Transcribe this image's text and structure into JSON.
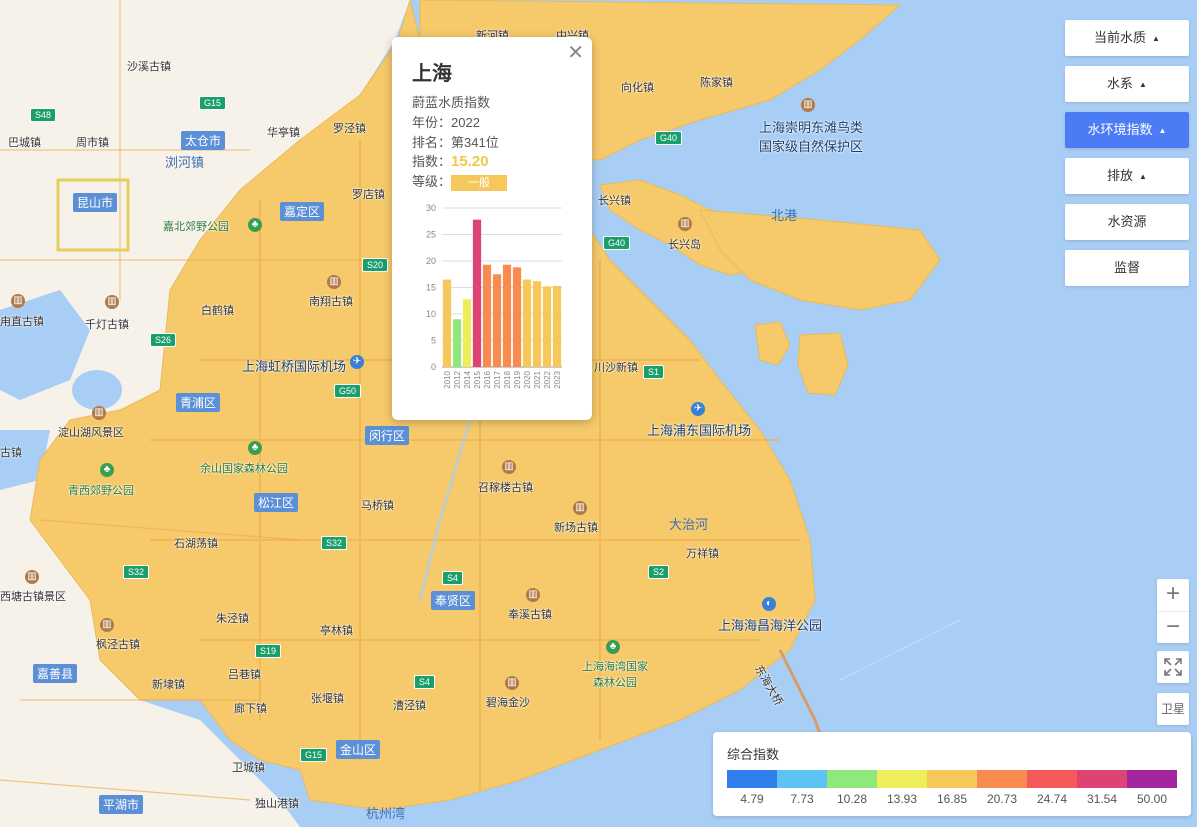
{
  "popup": {
    "city": "上海",
    "heading": "蔚蓝水质指数",
    "year_label": "年份：",
    "year": "2022",
    "rank_label": "排名：",
    "rank": "第341位",
    "index_label": "指数：",
    "index_value": "15.20",
    "grade_label": "等级：",
    "grade": "一般",
    "close_icon": "close-icon"
  },
  "chart_data": {
    "type": "bar",
    "categories": [
      "2010",
      "2012",
      "2014",
      "2015",
      "2016",
      "2017",
      "2018",
      "2019",
      "2020",
      "2021",
      "2022",
      "2023"
    ],
    "values": [
      16.5,
      9.0,
      12.8,
      27.8,
      19.3,
      17.5,
      19.3,
      18.8,
      16.5,
      16.2,
      15.2,
      15.3
    ],
    "colors": [
      "#f6c85c",
      "#8ee87c",
      "#eeee5c",
      "#de4473",
      "#f98b50",
      "#f98b50",
      "#f98b50",
      "#f98b50",
      "#f6c85c",
      "#f6c85c",
      "#f6c85c",
      "#f6c85c"
    ],
    "ylim": [
      0,
      30
    ],
    "yticks": [
      0,
      5,
      10,
      15,
      20,
      25,
      30
    ],
    "grid": true
  },
  "right_menu": [
    {
      "label": "当前水质",
      "arrow": "▲",
      "active": false
    },
    {
      "label": "水系",
      "arrow": "▲",
      "active": false
    },
    {
      "label": "水环境指数",
      "arrow": "▲",
      "active": true
    },
    {
      "label": "排放",
      "arrow": "▲",
      "active": false
    },
    {
      "label": "水资源",
      "arrow": "",
      "active": false
    },
    {
      "label": "监督",
      "arrow": "",
      "active": false
    }
  ],
  "zoom": {
    "in": "+",
    "out": "−",
    "fullscreen_icon": "fullscreen-icon",
    "satellite": "卫星"
  },
  "legend": {
    "title": "综合指数",
    "colors": [
      "#2f80ed",
      "#5cc3f5",
      "#8ee87c",
      "#eeee5c",
      "#f6c85c",
      "#f98b50",
      "#f55a5a",
      "#de4473",
      "#a326a0"
    ],
    "values": [
      "4.79",
      "7.73",
      "10.28",
      "13.93",
      "16.85",
      "20.73",
      "24.74",
      "31.54",
      "50.00"
    ]
  },
  "map_labels": {
    "towns": [
      "沙溪古镇",
      "浏河镇",
      "罗泾镇",
      "巴城镇",
      "周市镇",
      "华亭镇",
      "罗店镇",
      "嘉北郊野公园",
      "白鹤镇",
      "南翔古镇",
      "千灯古镇",
      "甪直古镇",
      "上海虹桥国际机场",
      "淀山湖风景区",
      "余山国家森林公园",
      "青西郊野公园",
      "召稼楼古镇",
      "马桥镇",
      "新场古镇",
      "大治河",
      "万祥镇",
      "石湖荡镇",
      "朱泾镇",
      "亭林镇",
      "奉溪古镇",
      "枫泾古镇",
      "新埭镇",
      "吕巷镇",
      "廊下镇",
      "张堰镇",
      "漕泾镇",
      "碧海金沙",
      "上海海湾国家森林公园",
      "上海海昌海洋公园",
      "独山港镇",
      "卫城镇",
      "上海浦东国际机场",
      "川沙新镇",
      "长兴镇",
      "长兴岛",
      "北港",
      "上海崇明东滩鸟类国家级自然保护区",
      "陈家镇",
      "向化镇",
      "新河镇",
      "中兴镇",
      "平湖市",
      "嘉善县",
      "杭州湾",
      "东海大桥",
      "西塘古镇景区",
      "古镇"
    ],
    "districts": [
      "太仓市",
      "昆山市",
      "嘉定区",
      "青浦区",
      "闵行区",
      "松江区",
      "奉贤区",
      "金山区",
      "嘉善县",
      "平湖市"
    ],
    "roads": [
      "G15",
      "S48",
      "G40",
      "S20",
      "S26",
      "G50",
      "S32",
      "S4",
      "S19",
      "S1",
      "S2",
      "G15",
      "G40",
      "S4",
      "S32"
    ]
  }
}
